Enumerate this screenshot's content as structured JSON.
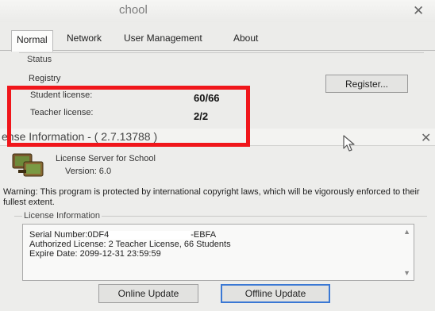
{
  "back_window": {
    "title": "chool",
    "tabs": [
      {
        "label": "Normal",
        "active": true
      },
      {
        "label": "Network",
        "active": false
      },
      {
        "label": "User Management",
        "active": false
      },
      {
        "label": "About",
        "active": false
      }
    ],
    "status_group_label": "Status",
    "registry_label": "Registry",
    "register_button": "Register...",
    "student_license_label": "Student license:",
    "student_license_value": "60/66",
    "teacher_license_label": "Teacher license:",
    "teacher_license_value": "2/2"
  },
  "dialog": {
    "title": "ense Information - ( 2.7.13788 )",
    "product_name": "License Server for School",
    "version": "Version: 6.0",
    "warning": "Warning: This program is protected by international copyright laws, which will be vigorously enforced to their fullest extent.",
    "info_group_label": "License Information",
    "info": {
      "serial_prefix": "Serial Number:0DF4",
      "serial_suffix": "-EBFA",
      "authorized": "Authorized License: 2 Teacher License, 66 Students",
      "expire": "Expire Date: 2099-12-31 23:59:59"
    },
    "online_update_button": "Online Update",
    "offline_update_button": "Offline Update"
  },
  "colors": {
    "highlight": "#f0161b",
    "focus_border": "#3a78d4"
  },
  "icons": {
    "back_close": "close-icon",
    "dialog_close": "close-icon",
    "cursor": "mouse-pointer-icon",
    "app": "license-server-app-icon"
  }
}
